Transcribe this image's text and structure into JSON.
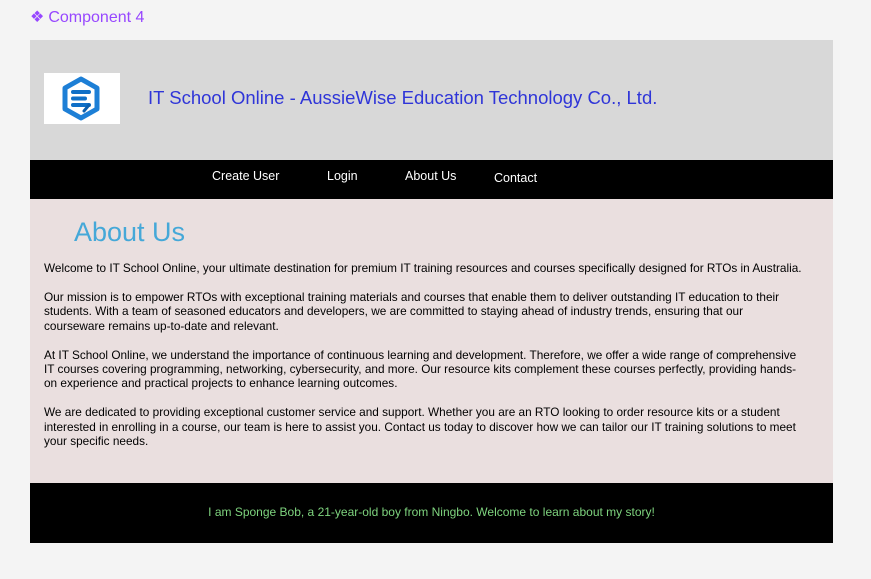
{
  "canvas": {
    "component_name": "Component 4",
    "component_icon": "component-icon"
  },
  "header": {
    "logo_icon": "logo-icon",
    "title": "IT School Online - AussieWise Education Technology Co., Ltd."
  },
  "nav": {
    "items": [
      {
        "label": "Create User"
      },
      {
        "label": "Login"
      },
      {
        "label": "About Us"
      },
      {
        "label": "Contact"
      }
    ]
  },
  "main": {
    "heading": "About Us",
    "paragraphs": [
      "Welcome to IT School Online, your ultimate destination for premium IT training resources and courses specifically designed for RTOs in Australia.",
      "Our mission is to empower RTOs with exceptional training materials and courses that enable them to deliver outstanding IT education to their students. With a team of seasoned educators and developers, we are committed to staying ahead of industry trends, ensuring that our courseware remains up-to-date and relevant.",
      "At IT School Online, we understand the importance of continuous learning and development. Therefore, we offer a wide range of comprehensive IT courses covering programming, networking, cybersecurity, and more. Our resource kits complement these courses perfectly, providing hands-on experience and practical projects to enhance learning outcomes.",
      "We are dedicated to providing exceptional customer service and support. Whether you are an RTO looking to order resource kits or a student interested in enrolling in a course, our team is here to assist you. Contact us today to discover how we can tailor our IT training solutions to meet your specific needs."
    ]
  },
  "footer": {
    "text": "I am Sponge Bob, a 21-year-old boy from Ningbo. Welcome to learn about my story!"
  },
  "colors": {
    "component_label": "#9747ff",
    "header_bg": "#d8d8d8",
    "title": "#2f35d8",
    "nav_bg": "#000000",
    "content_bg": "#eadfdf",
    "heading": "#45a8d8",
    "footer_text": "#7ed37e"
  }
}
